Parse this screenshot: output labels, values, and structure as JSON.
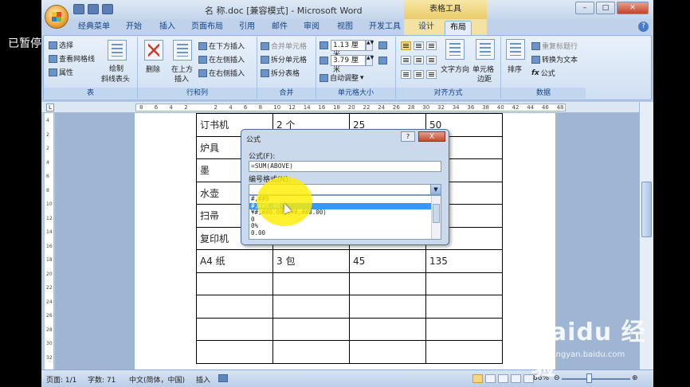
{
  "overlay": {
    "paused": "已暂停"
  },
  "window": {
    "title": "名 称.doc [兼容模式] - Microsoft Word",
    "context_tool": "表格工具"
  },
  "tabs": [
    "经典菜单",
    "开始",
    "插入",
    "页面布局",
    "引用",
    "邮件",
    "审阅",
    "视图",
    "开发工具",
    "设计",
    "布局"
  ],
  "ribbon": {
    "table": {
      "label": "表",
      "select": "选择",
      "gridlines": "查看网格线",
      "properties": "属性",
      "draw_line": "绘制",
      "draw_line2": "斜线表头"
    },
    "rows": {
      "label": "行和列",
      "delete": "删除",
      "insert_above": "在上方",
      "insert_above2": "插入",
      "insert_below": "在下方插入",
      "insert_left": "在左侧插入",
      "insert_right": "在右侧插入"
    },
    "merge": {
      "label": "合并",
      "merge_cells": "合并单元格",
      "split_cells": "拆分单元格",
      "split_table": "拆分表格"
    },
    "cell_size": {
      "label": "单元格大小",
      "height": "1.13 厘米",
      "width": "3.79 厘米",
      "autofit": "自动调整"
    },
    "alignment": {
      "label": "对齐方式",
      "text_direction": "文字方向",
      "cell_margins": "单元格",
      "cell_margins2": "边距"
    },
    "data": {
      "label": "数据",
      "sort": "排序",
      "repeat_header": "重复标题行",
      "convert_text": "转换为文本",
      "formula": "公式"
    }
  },
  "ruler": [
    "8",
    "6",
    "4",
    "2",
    "",
    "2",
    "4",
    "6",
    "8",
    "10",
    "12",
    "14",
    "16",
    "18",
    "20",
    "22",
    "24",
    "26",
    "28",
    "30",
    "32",
    "34",
    "36",
    "38",
    "40",
    "42",
    "44",
    "46",
    "48"
  ],
  "vruler": [
    "4",
    "2",
    "2",
    "4",
    "6",
    "8",
    "10",
    "12",
    "14",
    "16",
    "18",
    "20",
    "22",
    "24",
    "26",
    "28",
    "30",
    "32"
  ],
  "table_rows": [
    [
      "订书机",
      "2 个",
      "25",
      "50"
    ],
    [
      "炉具",
      "",
      "",
      ""
    ],
    [
      "墨",
      "",
      "",
      ""
    ],
    [
      "水壶",
      "",
      "",
      ""
    ],
    [
      "扫帚",
      "",
      "",
      ""
    ],
    [
      "复印机",
      "",
      "",
      ""
    ],
    [
      "A4 纸",
      "3 包",
      "45",
      "135"
    ],
    [
      "",
      "",
      "",
      ""
    ],
    [
      "",
      "",
      "",
      ""
    ],
    [
      "",
      "",
      "",
      ""
    ],
    [
      "",
      "",
      "",
      ""
    ]
  ],
  "dialog": {
    "title": "公式",
    "help": "?",
    "close": "X",
    "formula_label": "公式(F):",
    "formula_value": "=SUM(ABOVE)",
    "format_label": "编号格式(N):",
    "format_value": "",
    "options": [
      "#,##0",
      "#,##0.00",
      "¥#,##0.00;(¥#,##0.00)",
      "0",
      "0%",
      "0.00"
    ],
    "selected_index": 1
  },
  "status": {
    "page": "页面: 1/1",
    "words": "字数: 71",
    "lang": "中文(简体，中国)",
    "mode": "插入",
    "zoom": "86%"
  },
  "watermark": {
    "brand": "Baidu 经验",
    "url": "jingyan.baidu.com"
  }
}
